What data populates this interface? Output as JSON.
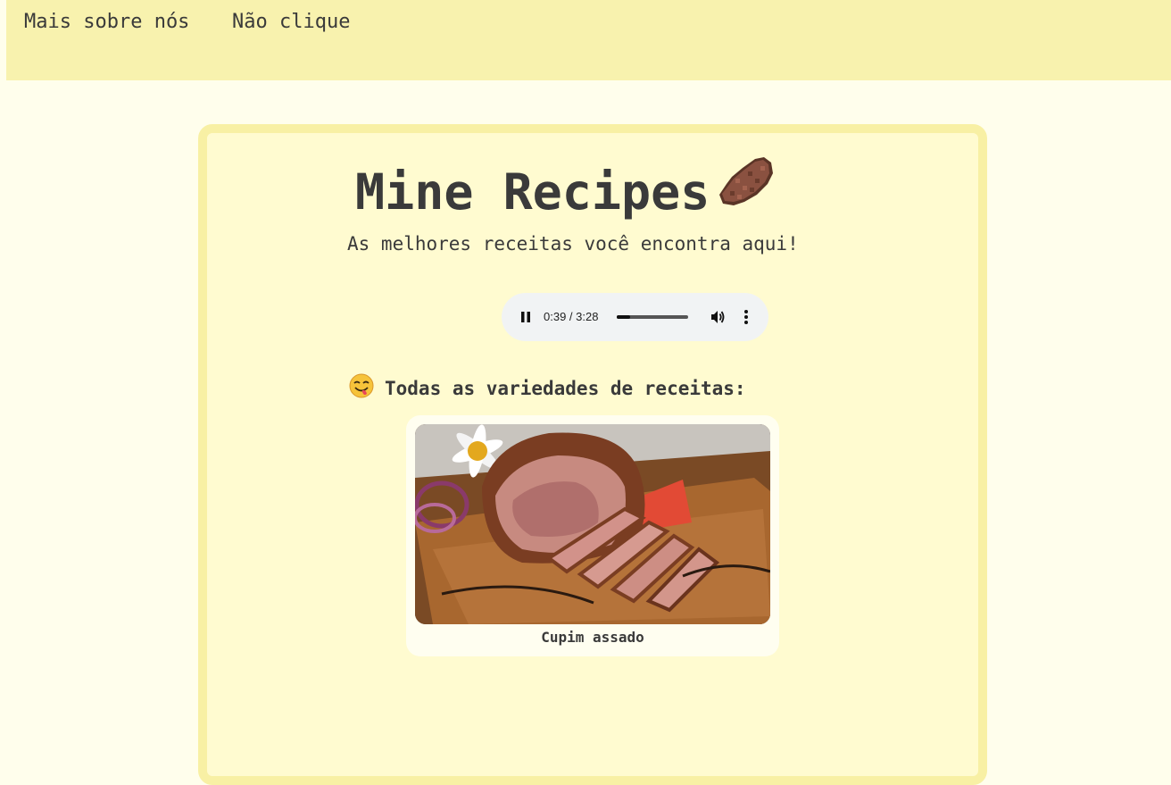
{
  "nav": {
    "about_label": "Mais sobre nós",
    "dont_click_label": "Não clique"
  },
  "header": {
    "title": "Mine Recipes",
    "title_icon": "steak-icon",
    "subtitle": "As melhores receitas você encontra aqui!"
  },
  "audio_player": {
    "state": "playing",
    "time_display": "0:39 / 3:28",
    "current_time": "0:39",
    "duration": "3:28",
    "progress_fraction": 0.19
  },
  "recipes_section": {
    "icon": "yum-face-emoji",
    "heading": "Todas as variedades de receitas:",
    "items": [
      {
        "name": "Cupim assado",
        "image": "roast-beef-photo"
      }
    ]
  },
  "colors": {
    "page_background": "#fffeec",
    "topbar_background": "#f8f2ae",
    "card_background": "#fffbd0",
    "card_border": "#f8f0a4",
    "text": "#3a3a3a"
  }
}
